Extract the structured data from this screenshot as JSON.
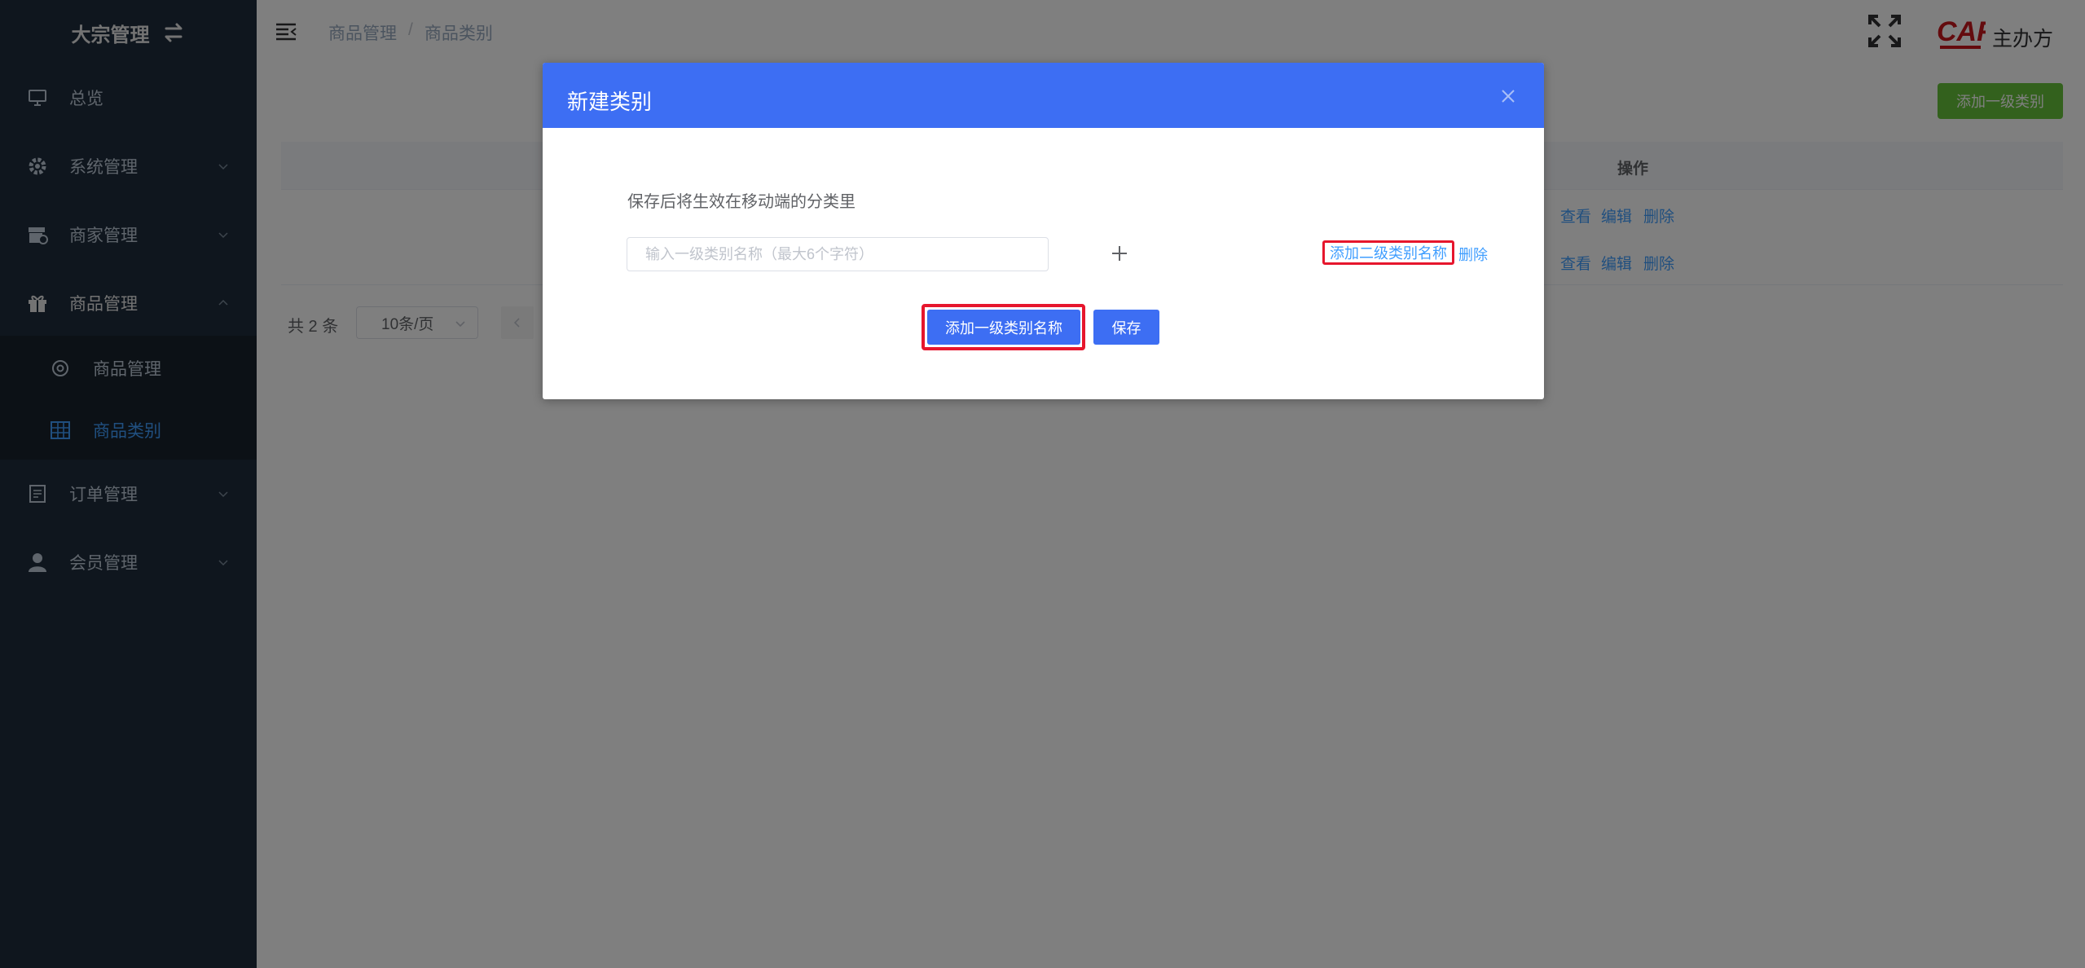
{
  "sidebar": {
    "brand": "大宗管理",
    "items": [
      {
        "label": "总览"
      },
      {
        "label": "系统管理"
      },
      {
        "label": "商家管理"
      },
      {
        "label": "商品管理"
      },
      {
        "label": "订单管理"
      },
      {
        "label": "会员管理"
      }
    ],
    "submenu": [
      {
        "label": "商品管理"
      },
      {
        "label": "商品类别"
      }
    ]
  },
  "header": {
    "breadcrumb": [
      "商品管理",
      "商品类别"
    ],
    "breadcrumb_sep": "/",
    "username": "主办方"
  },
  "main": {
    "add_button": "添加一级类别",
    "table": {
      "ops_header": "操作",
      "rows": [
        {
          "view": "查看",
          "edit": "编辑",
          "delete": "删除"
        },
        {
          "view": "查看",
          "edit": "编辑",
          "delete": "删除"
        }
      ]
    },
    "pagination": {
      "total": "共 2 条",
      "page_size": "10条/页"
    }
  },
  "dialog": {
    "title": "新建类别",
    "hint": "保存后将生效在移动端的分类里",
    "input_placeholder": "输入一级类别名称（最大6个字符）",
    "add_sub_link": "添加二级类别名称",
    "delete_link": "删除",
    "add_first_button": "添加一级类别名称",
    "save_button": "保存"
  },
  "colors": {
    "sidebar_bg": "#1f2d3d",
    "submenu_bg": "#18222c",
    "active_menu": "#409eff",
    "dialog_header": "#3d6ef3",
    "success": "#67c23a",
    "highlight": "#e6162d"
  },
  "icons": {
    "brand": "swap-icon",
    "overview": "monitor-icon",
    "system": "gear-icon",
    "merchant": "store-icon",
    "product": "gift-icon",
    "product_sub": "settings-icon",
    "category_sub": "grid-table-icon",
    "order": "document-icon",
    "member": "user-icon"
  }
}
